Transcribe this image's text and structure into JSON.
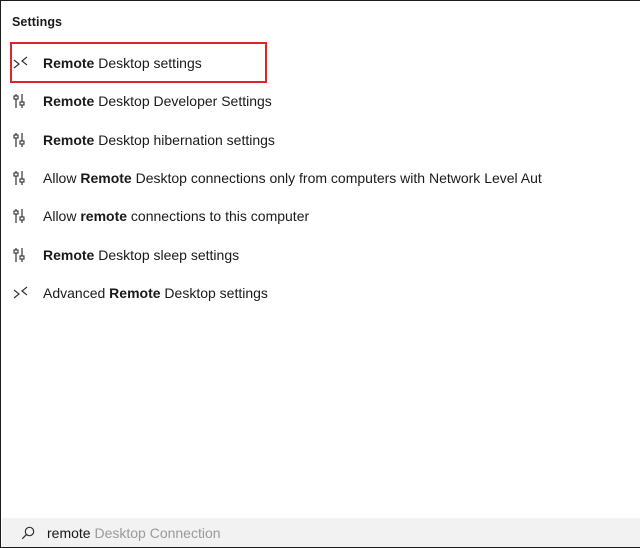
{
  "section": {
    "header": "Settings"
  },
  "results": [
    {
      "icon": "remote-desktop-icon",
      "pre": "",
      "bold": "Remote",
      "post": " Desktop settings"
    },
    {
      "icon": "settings-sliders-icon",
      "pre": "",
      "bold": "Remote",
      "post": " Desktop Developer Settings"
    },
    {
      "icon": "settings-sliders-icon",
      "pre": "",
      "bold": "Remote",
      "post": " Desktop hibernation settings"
    },
    {
      "icon": "settings-sliders-icon",
      "pre": "Allow ",
      "bold": "Remote",
      "post": " Desktop connections only from computers with Network Level Aut"
    },
    {
      "icon": "settings-sliders-icon",
      "pre": "Allow ",
      "bold": "remote",
      "post": " connections to this computer"
    },
    {
      "icon": "settings-sliders-icon",
      "pre": "",
      "bold": "Remote",
      "post": " Desktop sleep settings"
    },
    {
      "icon": "remote-desktop-icon",
      "pre": "Advanced ",
      "bold": "Remote",
      "post": " Desktop settings"
    }
  ],
  "search": {
    "typed": "remote",
    "suggestion": " Desktop Connection"
  },
  "colors": {
    "highlight_border": "#d9262b",
    "search_bg": "#f2f2f2",
    "suggestion_text": "#9a9a9a"
  }
}
